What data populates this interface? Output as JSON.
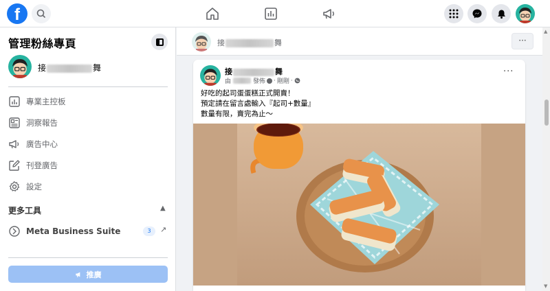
{
  "topbar": {
    "logo_letter": "f",
    "colors": {
      "brand": "#1877f2",
      "icon_gray": "#65676b"
    }
  },
  "sidebar": {
    "title": "管理粉絲專頁",
    "page_name_prefix": "接",
    "page_name_suffix": "舞",
    "menu": [
      {
        "label": "專業主控板",
        "icon": "dashboard-icon"
      },
      {
        "label": "洞察報告",
        "icon": "insights-icon"
      },
      {
        "label": "廣告中心",
        "icon": "megaphone-icon"
      },
      {
        "label": "刊登廣告",
        "icon": "edit-icon"
      },
      {
        "label": "設定",
        "icon": "gear-icon"
      }
    ],
    "more_tools": "更多工具",
    "tools": [
      {
        "label": "Meta Business Suite",
        "badge": "3",
        "icon": "meta-business-suite-icon"
      }
    ],
    "promote_label": "推廣"
  },
  "composer": {
    "name_prefix": "接",
    "name_suffix": "舞",
    "more": "···"
  },
  "post": {
    "name_prefix": "接",
    "name_suffix": "舞",
    "meta_by": "由",
    "meta_published": "發佈",
    "meta_just_now": "剛剛",
    "meta_sep": "·",
    "text_lines": [
      "好吃的起司蛋蛋糕正式開賣！",
      "預定請在留言處輸入『起司+數量』",
      "數量有限，賣完為止～"
    ],
    "more": "···"
  }
}
